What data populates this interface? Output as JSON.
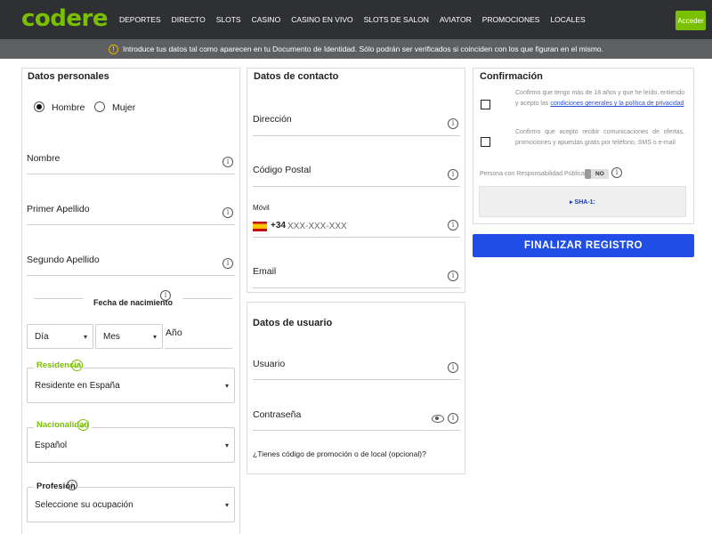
{
  "header": {
    "logo": "codere",
    "nav": [
      "DEPORTES",
      "DIRECTO",
      "SLOTS",
      "CASINO",
      "CASINO EN VIVO",
      "SLOTS DE SALON",
      "AVIATOR",
      "PROMOCIONES",
      "LOCALES"
    ],
    "login": "Acceder"
  },
  "info": {
    "icon": "!",
    "text": "Introduce tus datos tal como aparecen en tu Documento de Identidad. Sólo podrán ser verificados si coinciden con los que figuran en el mismo."
  },
  "personal": {
    "title": "Datos personales",
    "gender_male": "Hombre",
    "gender_female": "Mujer",
    "nombre": "Nombre",
    "apellido1": "Primer Apellido",
    "apellido2": "Segundo Apellido",
    "birth_title": "Fecha de nacimiento",
    "day": "Día",
    "month": "Mes",
    "year": "Año",
    "residencia_label": "Residencia",
    "residencia_value": "Residente en España",
    "nacionalidad_label": "Nacionalidad",
    "nacionalidad_value": "Español",
    "profesion_label": "Profesión",
    "profesion_value": "Seleccione su ocupación"
  },
  "contact": {
    "title": "Datos de contacto",
    "direccion": "Dirección",
    "cp": "Código Postal",
    "movil_label": "Móvil",
    "prefix": "+34",
    "phone_placeholder": "XXX-XXX-XXX",
    "email": "Email"
  },
  "user": {
    "title": "Datos de usuario",
    "usuario": "Usuario",
    "password": "Contraseña",
    "promo": "¿Tienes código de promoción o de local (opcional)?"
  },
  "confirm": {
    "title": "Confirmación",
    "terms_prefix": "Confirmo que tengo más de 18 años y que he leído, entiendo y acepto las ",
    "terms_link": "condiciones generales y la política de privacidad",
    "offers": "Confirmo que acepto recibir comunicaciones de ofertas, promociones y apuestas gratis por teléfono, SMS o e-mail",
    "ppr_label": "Persona con Responsabilidad Pública",
    "ppr_value": "NO",
    "sha": "▸ SHA-1:"
  },
  "finish": "FINALIZAR REGISTRO",
  "colors": {
    "brand_green": "#79c000",
    "header_bg": "#2f3033",
    "button_blue": "#1f4de6"
  }
}
